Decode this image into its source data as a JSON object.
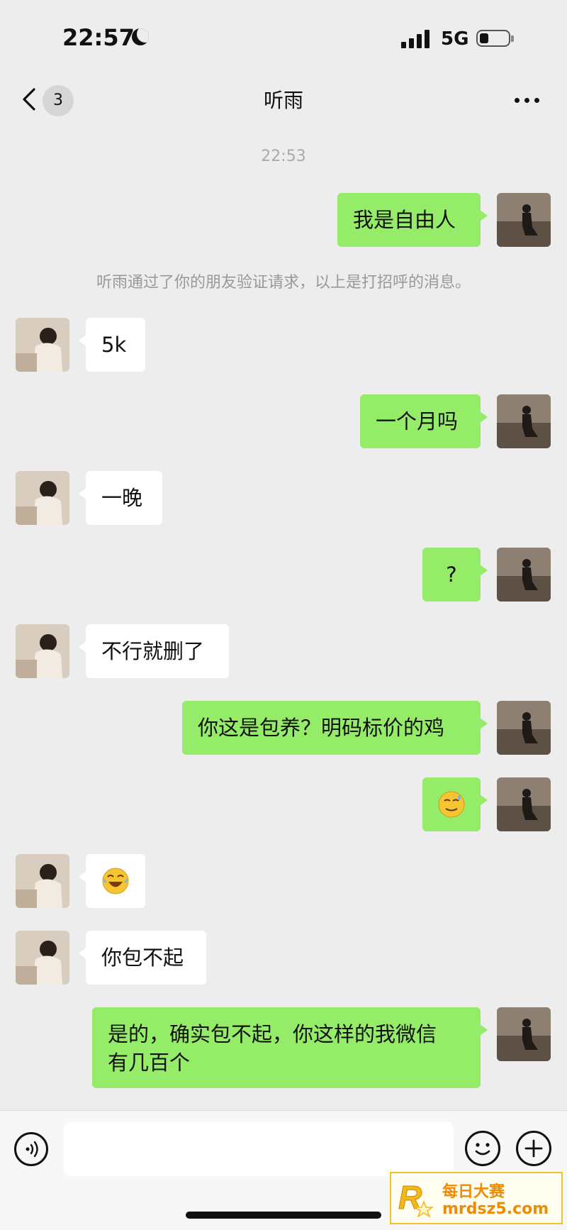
{
  "status_bar": {
    "time": "22:57",
    "network": "5G"
  },
  "nav": {
    "back_badge": "3",
    "title": "听雨"
  },
  "chat": {
    "timestamp": "22:53",
    "system_message": "听雨通过了你的朋友验证请求，以上是打招呼的消息。",
    "messages": [
      {
        "sender": "me",
        "text": "我是自由人"
      },
      {
        "sender": "them",
        "text": "5k"
      },
      {
        "sender": "me",
        "text": "一个月吗"
      },
      {
        "sender": "them",
        "text": "一晚"
      },
      {
        "sender": "me",
        "text": "?"
      },
      {
        "sender": "them",
        "text": "不行就删了"
      },
      {
        "sender": "me",
        "text": "你这是包养？明码标价的鸡"
      },
      {
        "sender": "me",
        "emoji": "sweat-smile-emoji"
      },
      {
        "sender": "them",
        "emoji": "laugh-cry-emoji"
      },
      {
        "sender": "them",
        "text": "你包不起"
      },
      {
        "sender": "me",
        "text": "是的，确实包不起，你这样的我微信\n有几百个"
      }
    ]
  },
  "input_bar": {
    "voice": "voice-icon",
    "emoji": "emoji-icon",
    "plus": "plus-icon"
  },
  "watermark": {
    "brand": "每日大赛",
    "url": "mrdsz5.com",
    "logo_letter": "R"
  },
  "colors": {
    "my_bubble": "#95ec69",
    "their_bubble": "#ffffff",
    "background": "#ededed"
  }
}
